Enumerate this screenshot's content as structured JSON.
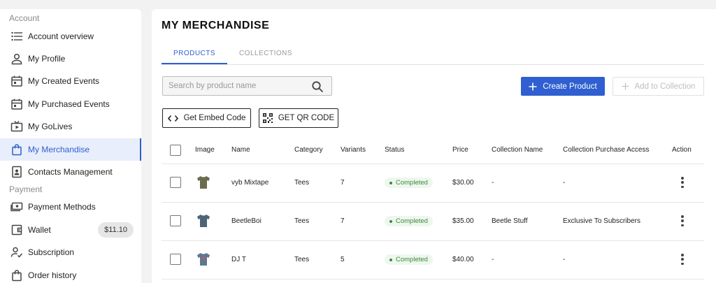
{
  "sidebar": {
    "section_account": "Account",
    "section_payment": "Payment",
    "items": [
      {
        "label": "Account overview",
        "icon": "list-icon"
      },
      {
        "label": "My Profile",
        "icon": "person-icon"
      },
      {
        "label": "My Created Events",
        "icon": "calendar-icon"
      },
      {
        "label": "My Purchased Events",
        "icon": "calendar-icon"
      },
      {
        "label": "My GoLives",
        "icon": "tv-icon"
      },
      {
        "label": "My Merchandise",
        "icon": "shopping-bag-icon",
        "active": true
      },
      {
        "label": "Contacts Management",
        "icon": "contact-card-icon"
      },
      {
        "label": "Payment Methods",
        "icon": "cash-icon"
      },
      {
        "label": "Wallet",
        "icon": "wallet-icon",
        "badge": "$11.10"
      },
      {
        "label": "Subscription",
        "icon": "person-check-icon"
      },
      {
        "label": "Order history",
        "icon": "shopping-bag-icon"
      }
    ]
  },
  "page": {
    "title": "MY MERCHANDISE",
    "tabs": [
      {
        "label": "PRODUCTS",
        "active": true
      },
      {
        "label": "COLLECTIONS",
        "active": false
      }
    ],
    "search_placeholder": "Search by product name",
    "create_product_label": "Create Product",
    "add_to_collection_label": "Add to Collection",
    "get_embed_code_label": "Get Embed Code",
    "get_qr_code_label": "GET QR CODE"
  },
  "table": {
    "headers": {
      "image": "Image",
      "name": "Name",
      "category": "Category",
      "variants": "Variants",
      "status": "Status",
      "price": "Price",
      "collection_name": "Collection Name",
      "collection_access": "Collection Purchase Access",
      "action": "Action"
    },
    "rows": [
      {
        "name": "vyb Mixtape",
        "category": "Tees",
        "variants": "7",
        "status": "Completed",
        "price": "$30.00",
        "collection": "-",
        "access": "-",
        "shirt_color": "#6b6b4e"
      },
      {
        "name": "BeetleBoi",
        "category": "Tees",
        "variants": "7",
        "status": "Completed",
        "price": "$35.00",
        "collection": "Beetle Stuff",
        "access": "Exclusive To Subscribers",
        "shirt_color": "#4d6577"
      },
      {
        "name": "DJ T",
        "category": "Tees",
        "variants": "5",
        "status": "Completed",
        "price": "$40.00",
        "collection": "-",
        "access": "-",
        "shirt_color": "#5d7891"
      }
    ]
  },
  "colors": {
    "accent": "#2f5fd0",
    "status_green": "#3a8a3a"
  }
}
